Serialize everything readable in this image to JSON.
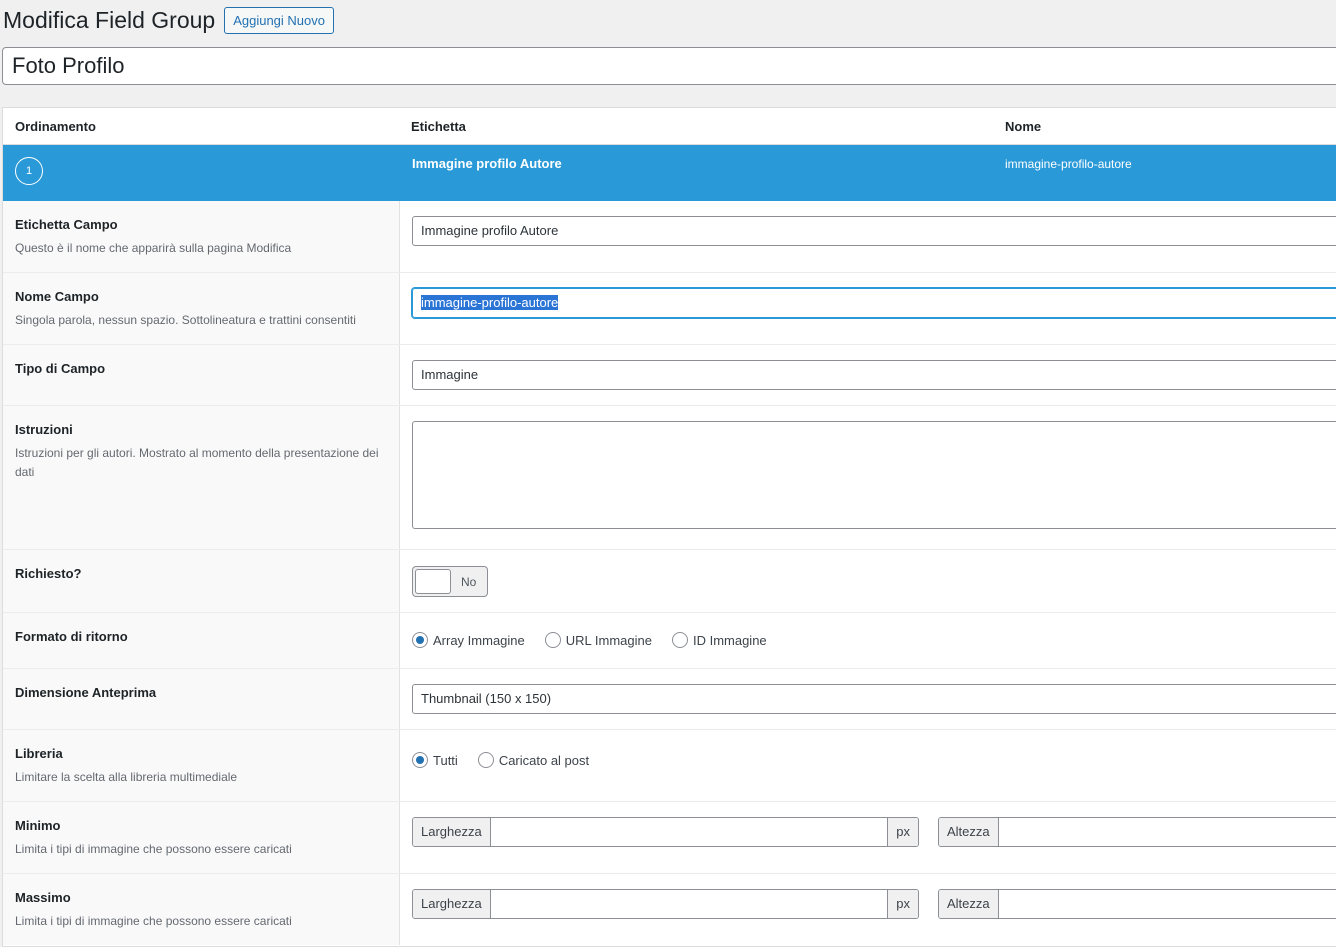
{
  "header": {
    "title": "Modifica Field Group",
    "add_new_label": "Aggiungi Nuovo"
  },
  "group_title_value": "Foto Profilo",
  "table": {
    "columns": [
      "Ordinamento",
      "Etichetta",
      "Nome"
    ]
  },
  "field": {
    "order": "1",
    "label": "Immagine profilo Autore",
    "name": "immagine-profilo-autore"
  },
  "settings": {
    "field_label": {
      "title": "Etichetta Campo",
      "desc": "Questo è il nome che apparirà sulla pagina Modifica",
      "value": "Immagine profilo Autore"
    },
    "field_name": {
      "title": "Nome Campo",
      "desc": "Singola parola, nessun spazio. Sottolineatura e trattini consentiti",
      "value": "immagine-profilo-autore"
    },
    "field_type": {
      "title": "Tipo di Campo",
      "value": "Immagine"
    },
    "instructions": {
      "title": "Istruzioni",
      "desc": "Istruzioni per gli autori. Mostrato al momento della presentazione dei dati",
      "value": ""
    },
    "required": {
      "title": "Richiesto?",
      "toggle_label": "No"
    },
    "return_format": {
      "title": "Formato di ritorno",
      "options": [
        "Array Immagine",
        "URL Immagine",
        "ID Immagine"
      ],
      "selected": "Array Immagine"
    },
    "preview_size": {
      "title": "Dimensione Anteprima",
      "value": "Thumbnail (150 x 150)"
    },
    "library": {
      "title": "Libreria",
      "desc": "Limitare la scelta alla libreria multimediale",
      "options": [
        "Tutti",
        "Caricato al post"
      ],
      "selected": "Tutti"
    },
    "minimum": {
      "title": "Minimo",
      "desc": "Limita i tipi di immagine che possono essere caricati",
      "width_label": "Larghezza",
      "height_label": "Altezza",
      "unit": "px"
    },
    "maximum": {
      "title": "Massimo",
      "desc": "Limita i tipi di immagine che possono essere caricati",
      "width_label": "Larghezza",
      "height_label": "Altezza",
      "unit": "px"
    }
  },
  "colors": {
    "accent": "#2a99d8",
    "link": "#2271b1"
  }
}
